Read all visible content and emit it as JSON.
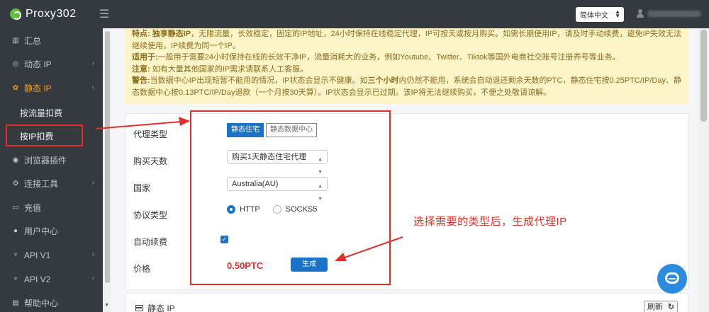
{
  "header": {
    "logo_text": "Proxy302",
    "hamburger_icon": "☰",
    "language": "简体中文",
    "user_name": ""
  },
  "sidebar": {
    "items": [
      {
        "label": "汇总",
        "icon": "dashboard-icon"
      },
      {
        "label": "动态 IP",
        "icon": "globe-icon",
        "chevron": "›"
      },
      {
        "label": "静态 IP",
        "icon": "gear-icon",
        "chevron": "‹"
      },
      {
        "label": "浏览器插件",
        "icon": "browser-icon"
      },
      {
        "label": "连接工具",
        "icon": "tool-icon",
        "chevron": "›"
      },
      {
        "label": "充值",
        "icon": "card-icon"
      },
      {
        "label": "用户中心",
        "icon": "user-icon"
      },
      {
        "label": "API V1",
        "icon": "api-icon",
        "chevron": "›"
      },
      {
        "label": "API V2",
        "icon": "api-icon",
        "chevron": "›"
      },
      {
        "label": "帮助中心",
        "icon": "help-icon"
      }
    ],
    "subitems": [
      {
        "label": "按流量扣费"
      },
      {
        "label": "按IP扣费"
      }
    ]
  },
  "notice": {
    "features_label": "特点:",
    "features_highlight": "独享静态IP",
    "features_text": "，无限流量，长效稳定，固定的IP地址，24小时保持在线稳定代理，IP可按天或按月购买。如需长期使用IP，请及时手动续费，避免IP失效无法继续使用，IP续费为同一个IP。",
    "suitable_label": "适用于:",
    "suitable_text": "一般用于需要24小时保持在线的长效干净IP，流量消耗大的业务，例如Youtube、Twitter、Tiktok等国外电商社交账号注册养号等业务。",
    "note_label": "注意:",
    "note_text": "如有大量其他国家的IP需求请联系人工客服。",
    "warning_label": "警告:",
    "warning_text_1": "当数据中心IP出现短暂不能用的情况，IP状态会显示不健康。如",
    "warning_highlight": "三个小时",
    "warning_text_2": "内仍然不能用，系统会自动退还剩余天数的PTC，静态住宅按0.25PTC/IP/Day、静态数据中心按0.13PTC/IP/Day退款（一个月按30天算）。IP状态会显示已过期。该IP将无法继续购买，不便之处敬请谅解。"
  },
  "form": {
    "proxy_type_label": "代理类型",
    "proxy_type_options": [
      "静态住宅",
      "静态数据中心"
    ],
    "days_label": "购买天数",
    "days_value": "购买1天静态住宅代理",
    "country_label": "国家",
    "country_value": "Australia(AU)",
    "protocol_label": "协议类型",
    "protocol_options": [
      "HTTP",
      "SOCKS5"
    ],
    "auto_renew_label": "自动续费",
    "auto_renew_checked": true,
    "price_label": "价格",
    "price_value": "0.50PTC",
    "generate_button": "生成"
  },
  "annotation": "选择需要的类型后，生成代理IP",
  "static_ip_card": {
    "title": "静态 IP",
    "refresh_button": "刷新"
  },
  "colors": {
    "sidebar_bg": "#343a40",
    "accent_blue": "#1a73c9",
    "annotation_red": "#e0302a",
    "notice_bg": "#fdf4c8",
    "active_orange": "#f0a020"
  }
}
